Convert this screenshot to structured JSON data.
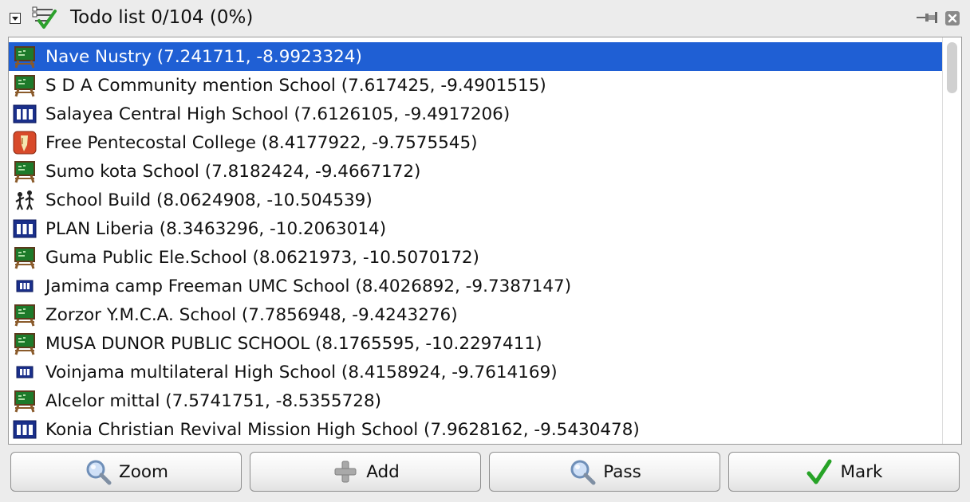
{
  "panel": {
    "title": "Todo list 0/104 (0%)"
  },
  "items": [
    {
      "label": "Nave Nustry (7.241711, -8.9923324)",
      "icon": "school-board-icon",
      "selected": true
    },
    {
      "label": "S  D A  Community mention School (7.617425, -9.4901515)",
      "icon": "school-board-icon",
      "selected": false
    },
    {
      "label": "Salayea Central High School (7.6126105, -9.4917206)",
      "icon": "high-school-icon",
      "selected": false
    },
    {
      "label": "Free Pentecostal College (8.4177922, -9.7575545)",
      "icon": "college-icon",
      "selected": false
    },
    {
      "label": "Sumo kota  School (7.8182424, -9.4667172)",
      "icon": "school-board-icon",
      "selected": false
    },
    {
      "label": "School  Build (8.0624908, -10.504539)",
      "icon": "children-icon",
      "selected": false
    },
    {
      "label": "PLAN Liberia (8.3463296, -10.2063014)",
      "icon": "high-school-icon",
      "selected": false
    },
    {
      "label": "Guma Public Ele.School (8.0621973, -10.5070172)",
      "icon": "school-board-icon",
      "selected": false
    },
    {
      "label": "Jamima camp Freeman UMC School (8.4026892, -9.7387147)",
      "icon": "small-building-icon",
      "selected": false
    },
    {
      "label": "Zorzor   Y.M.C.A.  School (7.7856948, -9.4243276)",
      "icon": "school-board-icon",
      "selected": false
    },
    {
      "label": "MUSA DUNOR PUBLIC SCHOOL (8.1765595, -10.2297411)",
      "icon": "school-board-icon",
      "selected": false
    },
    {
      "label": "Voinjama multilateral High School (8.4158924, -9.7614169)",
      "icon": "small-building-icon",
      "selected": false
    },
    {
      "label": "Alcelor mittal (7.5741751, -8.5355728)",
      "icon": "school-board-icon",
      "selected": false
    },
    {
      "label": "Konia Christian Revival Mission High School (7.9628162, -9.5430478)",
      "icon": "high-school-icon",
      "selected": false
    }
  ],
  "buttons": {
    "zoom": "Zoom",
    "add": "Add",
    "pass": "Pass",
    "mark": "Mark"
  },
  "colors": {
    "selection": "#1f5fd4"
  }
}
